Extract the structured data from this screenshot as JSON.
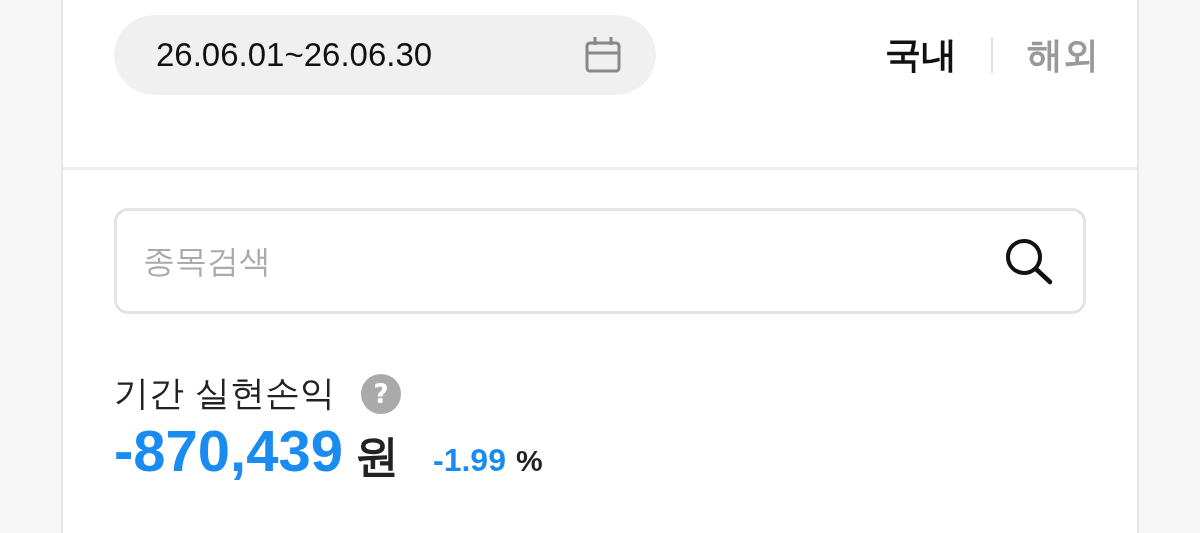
{
  "date_range": {
    "value": "26.06.01~26.06.30"
  },
  "market_tabs": [
    {
      "label": "국내",
      "selected": true
    },
    {
      "label": "해외",
      "selected": false
    }
  ],
  "search": {
    "placeholder": "종목검색"
  },
  "summary": {
    "title": "기간 실현손익",
    "help": "?",
    "amount": "-870,439",
    "amount_unit": "원",
    "rate": "-1.99",
    "rate_unit": "%"
  }
}
